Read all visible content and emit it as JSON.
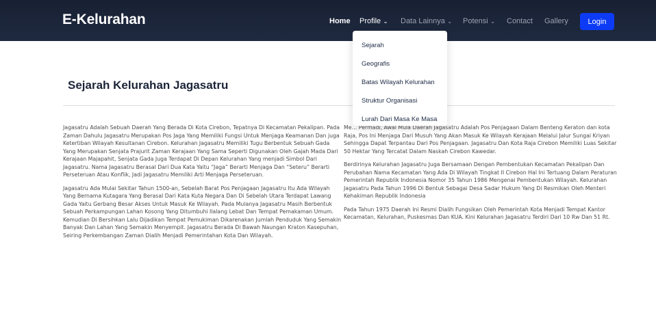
{
  "brand": "E-Kelurahan",
  "nav": {
    "home": "Home",
    "profile": "Profile",
    "data_lainnya": "Data Lainnya",
    "potensi": "Potensi",
    "contact": "Contact",
    "gallery": "Gallery",
    "login": "Login"
  },
  "dropdown": {
    "items": [
      "Sejarah",
      "Geografis",
      "Batas Wilayah Kelurahan",
      "Struktur Organisasi",
      "Lurah Dari Masa Ke Masa"
    ]
  },
  "page": {
    "title": "Sejarah Kelurahan Jagasatru",
    "left_paragraphs": [
      "Jagasatru Adalah Sebuah Daerah Yang Berada Di Kota Cirebon, Tepatnya Di Kecamatan Pekalipan. Pada Zaman Dahulu Jagasatru Merupakan Pos Jaga Yang Memiliki Fungsi Untuk Menjaga Keamanan Dan juga Ketertiban Wilayah Kesultanan Cirebon. Kelurahan Jagasatru Memiliki Tugu Berbentuk Sebuah Gada Yang Merupakan Senjata Prajurit Zaman Kerajaan Yang Sama Seperti Digunakan Oleh Gajah Mada Dari Kerajaan Majapahit, Senjata Gada Juga Terdapat Di Depan Kelurahan Yang menjadi Simbol Dari Jagasatru. Nama Jagasatru Berasal Dari Dua Kata Yaitu “Jaga” Berarti Menjaga Dan “Seteru” Berarti Perseteruan Atau Konflik, Jadi Jagasatru Memiliki Arti Menjaga Perseteruan.",
      "Jagasatru Ada Mulai Sekitar Tahun 1500-an, Sebelah Barat Pos Penjagaan Jagasatru Itu Ada Wilayah Yang Bernama Kutagara Yang Berasal Dari Kata Kuta Negara Dan Di Sebelah Utara Terdapat Lawang Gada Yaitu Gerbang Besar Akses Untuk Masuk Ke Wilayah. Pada Mulanya Jagasatru Masih Berbentuk Sebuah Perkampungan Lahan Kosong Yang Ditumbuhi Ilalang Lebat Dan Tempat Pemakaman Umum. Kemudian Di Bersihkan Lalu Dijadikan Tempat Pemukiman Dikarenakan Jumlah Penduduk Yang Semakin Banyak Dan Lahan Yang Semakin Menyempit. Jagasatru Berada Di Bawah Naungan Kraton Kasepuhan, Seiring Perkembangan Zaman Dialih Menjadi Pemerintahan Kota Dan Wilayah."
    ],
    "right_paragraphs": [
      "Me… Permadi, Awal Mula Daerah Jagasatru Adalah Pos Penjagaan Dalam Benteng Keraton dan kota Raja, Pos Ini Menjaga Dari Musuh Yang Akan Masuk Ke Wilayah Kerajaan Melalui Jalur Sungai Kriyan Sehingga Dapat Terpantau Dari Pos Penjagaan. Jagasatru Dan Kota Raja Cirebon Memiliki Luas Sekitar 50 Hektar Yang Tercatat Dalam Naskah Cirebon Kawedar.",
      "Berdirinya Kelurahan Jagasatru Juga Bersamaan Dengan Pembentukan Kecamatan Pekalipan Dan Perubahan Nama Kecamatan Yang Ada Di Wilayah Tingkat II Cirebon Hal Ini Tertuang Dalam Peraturan Pemerintah Republik Indonesia Nomor 35 Tahun 1986 Mengenai Pembentukan Wilayah. Kelurahan Jagasatru Pada Tahun 1996 Di Bentuk Sebagai Desa Sadar Hukum Yang Di Resmikan Oleh Menteri Kehakiman Republik Indonesia",
      "Pada Tahun 1975 Daerah Ini Resmi Dialih Fungsikan Oleh Pemerintah Kota Menjadi Tempat Kantor Kecamatan, Kelurahan, Puskesmas Dan KUA. Kini Kelurahan Jagasatru Terdiri Dari 10 Rw Dan 51 Rt."
    ]
  },
  "colors": {
    "navbar": "#1f2a40",
    "login_button": "#0d3bf5",
    "title": "#1b2438"
  }
}
